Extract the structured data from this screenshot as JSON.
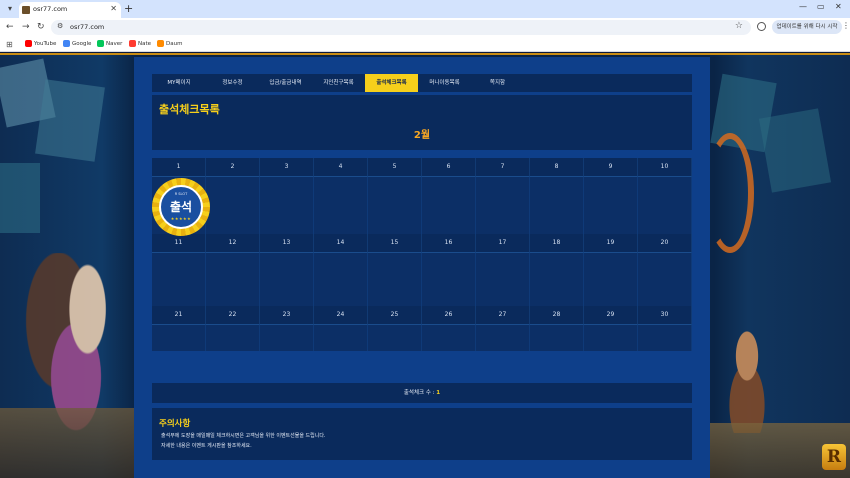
{
  "browser": {
    "tab_title": "osr77.com",
    "url": "osr77.com",
    "relaunch_label": "업데이트를 위해 다시 시작",
    "bookmarks": [
      {
        "label": "YouTube",
        "color": "#ff0000"
      },
      {
        "label": "Google",
        "color": "#4285f4"
      },
      {
        "label": "Naver",
        "color": "#03c75a"
      },
      {
        "label": "Nate",
        "color": "#ff3b30"
      },
      {
        "label": "Daum",
        "color": "#ff8a00"
      }
    ]
  },
  "nav": {
    "tabs": [
      {
        "label": "MY페이지",
        "active": false
      },
      {
        "label": "정보수정",
        "active": false
      },
      {
        "label": "입금/출금내역",
        "active": false
      },
      {
        "label": "지인친구목록",
        "active": false
      },
      {
        "label": "출석체크목록",
        "active": true
      },
      {
        "label": "머니이동목록",
        "active": false
      },
      {
        "label": "쪽지함",
        "active": false
      }
    ]
  },
  "attendance": {
    "title": "출석체크목록",
    "month": "2월",
    "stamp_brand": "R SLOT",
    "stamp_text": "출석",
    "stamp_stars": "★★★★★",
    "days": [
      1,
      2,
      3,
      4,
      5,
      6,
      7,
      8,
      9,
      10,
      11,
      12,
      13,
      14,
      15,
      16,
      17,
      18,
      19,
      20,
      21,
      22,
      23,
      24,
      25,
      26,
      27,
      28,
      29,
      30
    ],
    "checked_days": [
      1
    ],
    "count_label": "출석체크 수 :",
    "count_value": "1"
  },
  "notice": {
    "title": "주의사항",
    "lines": [
      "출석부에 도장을 매일매일 체크하시면은 고객님을 위한 이벤트선물을 드립니다.",
      "자세한 내용은 이벤트 게시판을 참조하세요."
    ]
  },
  "colors": {
    "accent": "#f6cf1b",
    "panel": "#0e3f8a",
    "box": "#0a2a5c"
  }
}
